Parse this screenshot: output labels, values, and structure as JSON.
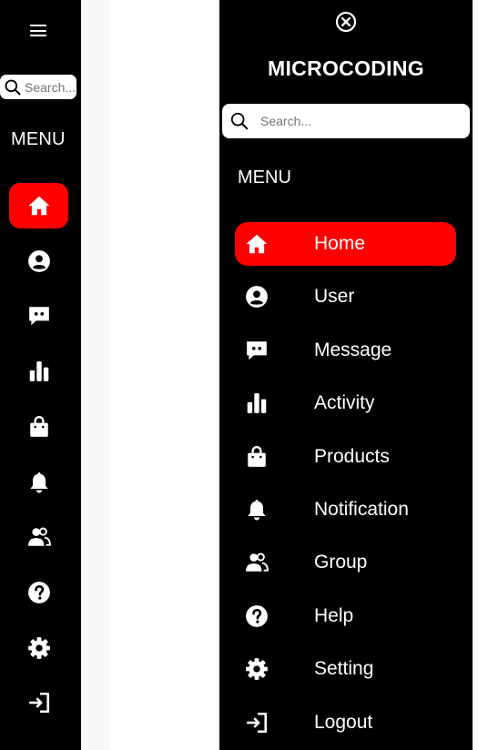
{
  "brand": "MICROCODING",
  "menu_label": "MENU",
  "mini_search": {
    "placeholder": "Search..."
  },
  "full_search": {
    "placeholder": "Search..."
  },
  "nav": [
    {
      "key": "home",
      "label": "Home",
      "icon": "home-icon",
      "active": true
    },
    {
      "key": "user",
      "label": "User",
      "icon": "user-circle-icon",
      "active": false
    },
    {
      "key": "message",
      "label": "Message",
      "icon": "message-icon",
      "active": false
    },
    {
      "key": "activity",
      "label": "Activity",
      "icon": "bar-chart-icon",
      "active": false
    },
    {
      "key": "products",
      "label": "Products",
      "icon": "shopping-bag-icon",
      "active": false
    },
    {
      "key": "notification",
      "label": "Notification",
      "icon": "bell-icon",
      "active": false
    },
    {
      "key": "group",
      "label": "Group",
      "icon": "group-icon",
      "active": false
    },
    {
      "key": "help",
      "label": "Help",
      "icon": "help-icon",
      "active": false
    },
    {
      "key": "setting",
      "label": "Setting",
      "icon": "gear-icon",
      "active": false
    },
    {
      "key": "logout",
      "label": "Logout",
      "icon": "logout-icon",
      "active": false
    }
  ],
  "colors": {
    "sidebar_bg": "#000000",
    "active_bg": "#ff0000",
    "text": "#ffffff",
    "strip": "#f8f8f8"
  }
}
